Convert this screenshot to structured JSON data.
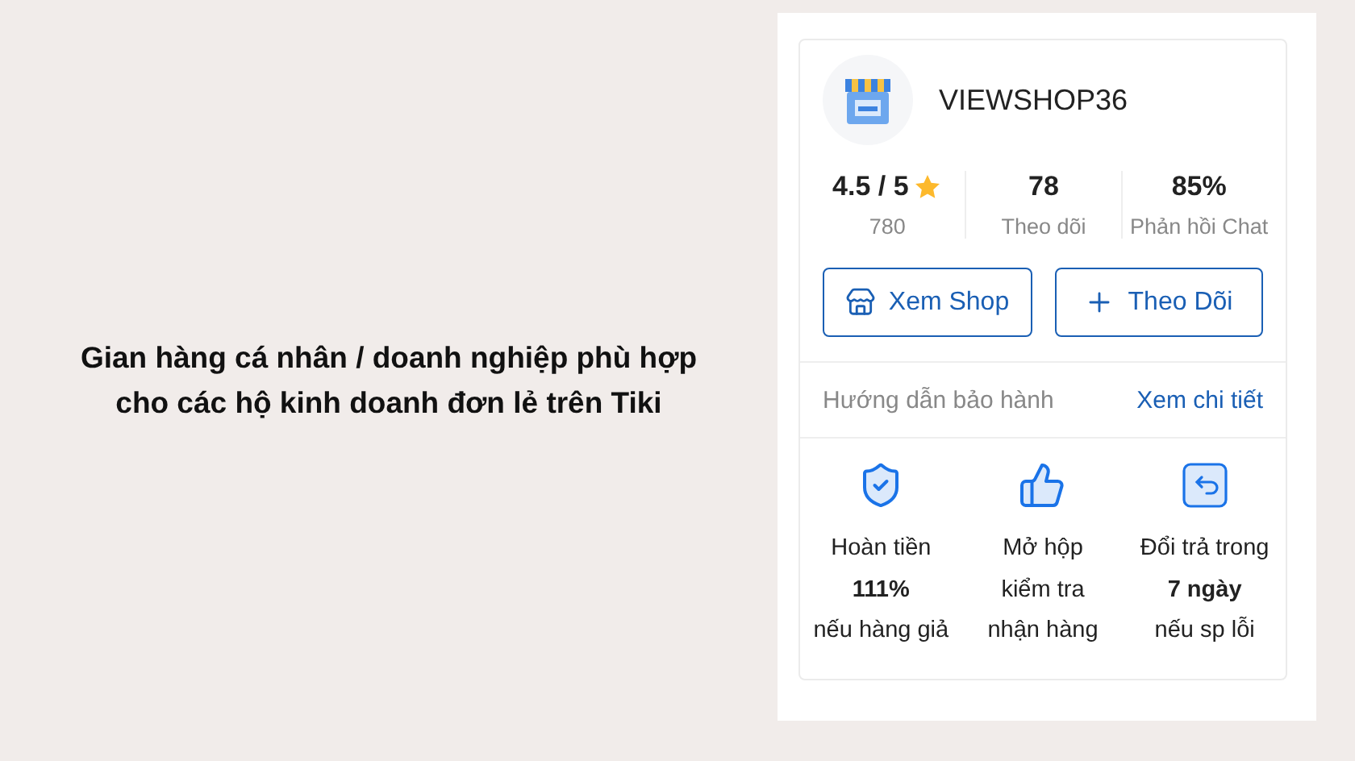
{
  "caption": [
    "Gian hàng cá nhân / doanh nghiệp phù hợp",
    "cho các hộ kinh doanh đơn lẻ trên Tiki"
  ],
  "shop": {
    "name": "VIEWSHOP36"
  },
  "stats": [
    {
      "kind": "rating",
      "value": "4.5 / 5",
      "label": "780"
    },
    {
      "kind": "plain",
      "value": "78",
      "label": "Theo dõi"
    },
    {
      "kind": "plain",
      "value": "85%",
      "label": "Phản hồi Chat"
    }
  ],
  "buttons": [
    {
      "kind": "shop",
      "label": "Xem Shop"
    },
    {
      "kind": "follow",
      "label": "Theo Dõi"
    }
  ],
  "warranty": {
    "label": "Hướng dẫn bảo hành",
    "link": "Xem chi tiết"
  },
  "guarantees": [
    {
      "kind": "shield",
      "lines": [
        "Hoàn tiền",
        "**111%**",
        "nếu hàng giả"
      ]
    },
    {
      "kind": "thumb",
      "lines": [
        "Mở hộp",
        "kiểm tra",
        "nhận hàng"
      ]
    },
    {
      "kind": "return",
      "lines": [
        "Đổi trả trong",
        "**7 ngày**",
        "nếu sp lỗi"
      ]
    }
  ]
}
